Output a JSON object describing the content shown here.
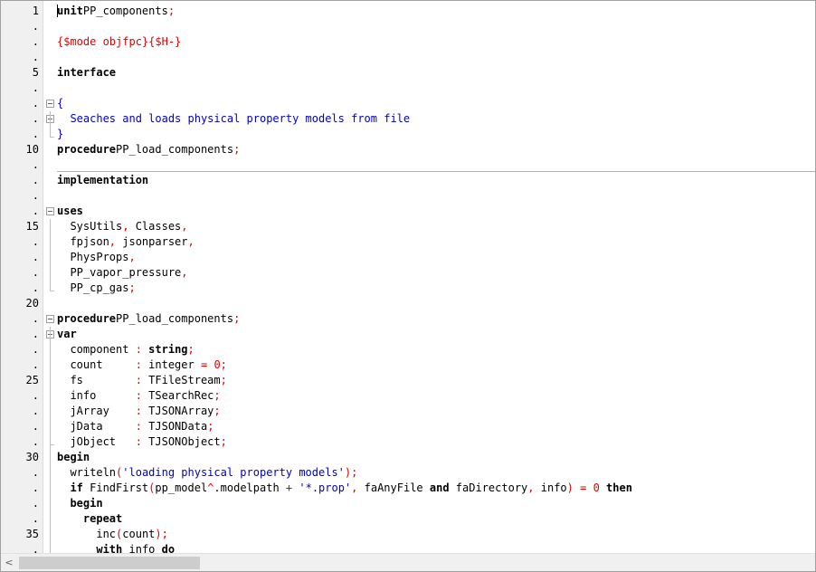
{
  "editor": {
    "lines": [
      {
        "n": "1",
        "code": [
          [
            "kw",
            "unit"
          ],
          [
            "",
            "PP_components"
          ],
          [
            "sym",
            ";"
          ]
        ]
      },
      {
        "n": ".",
        "code": []
      },
      {
        "n": ".",
        "code": [
          [
            "dir",
            "{$mode objfpc}{$H-}"
          ]
        ]
      },
      {
        "n": ".",
        "code": []
      },
      {
        "n": "5",
        "code": [
          [
            "kw",
            "interface"
          ]
        ]
      },
      {
        "n": ".",
        "code": []
      },
      {
        "n": ".",
        "code": [
          [
            "cm",
            "{"
          ]
        ]
      },
      {
        "n": ".",
        "code": [
          [
            "cm",
            "  Seaches and loads physical property models from file"
          ]
        ]
      },
      {
        "n": ".",
        "code": [
          [
            "cm",
            "}"
          ]
        ]
      },
      {
        "n": "10",
        "code": [
          [
            "kw",
            "procedure"
          ],
          [
            "",
            "PP_load_components"
          ],
          [
            "sym",
            ";"
          ]
        ]
      },
      {
        "n": ".",
        "code": []
      },
      {
        "n": ".",
        "code": [
          [
            "kw",
            "implementation"
          ]
        ]
      },
      {
        "n": ".",
        "code": []
      },
      {
        "n": ".",
        "code": [
          [
            "kw",
            "uses"
          ]
        ]
      },
      {
        "n": "15",
        "code": [
          [
            "",
            "  SysUtils"
          ],
          [
            "sym",
            ","
          ],
          [
            "",
            " Classes"
          ],
          [
            "sym",
            ","
          ]
        ]
      },
      {
        "n": ".",
        "code": [
          [
            "",
            "  fpjson"
          ],
          [
            "sym",
            ","
          ],
          [
            "",
            " jsonparser"
          ],
          [
            "sym",
            ","
          ]
        ]
      },
      {
        "n": ".",
        "code": [
          [
            "",
            "  PhysProps"
          ],
          [
            "sym",
            ","
          ]
        ]
      },
      {
        "n": ".",
        "code": [
          [
            "",
            "  PP_vapor_pressure"
          ],
          [
            "sym",
            ","
          ]
        ]
      },
      {
        "n": ".",
        "code": [
          [
            "",
            "  PP_cp_gas"
          ],
          [
            "sym",
            ";"
          ]
        ]
      },
      {
        "n": "20",
        "code": []
      },
      {
        "n": ".",
        "code": [
          [
            "kw",
            "procedure"
          ],
          [
            "",
            "PP_load_components"
          ],
          [
            "sym",
            ";"
          ]
        ]
      },
      {
        "n": ".",
        "code": [
          [
            "kw",
            "var"
          ]
        ]
      },
      {
        "n": ".",
        "code": [
          [
            "",
            "  component "
          ],
          [
            "sym",
            ":"
          ],
          [
            "",
            " "
          ],
          [
            "kw",
            "string"
          ],
          [
            "sym",
            ";"
          ]
        ]
      },
      {
        "n": ".",
        "code": [
          [
            "",
            "  count     "
          ],
          [
            "sym",
            ":"
          ],
          [
            "",
            " integer "
          ],
          [
            "sym",
            "="
          ],
          [
            "",
            " "
          ],
          [
            "num",
            "0"
          ],
          [
            "sym",
            ";"
          ]
        ]
      },
      {
        "n": "25",
        "code": [
          [
            "",
            "  fs        "
          ],
          [
            "sym",
            ":"
          ],
          [
            "",
            " TFileStream"
          ],
          [
            "sym",
            ";"
          ]
        ]
      },
      {
        "n": ".",
        "code": [
          [
            "",
            "  info      "
          ],
          [
            "sym",
            ":"
          ],
          [
            "",
            " TSearchRec"
          ],
          [
            "sym",
            ";"
          ]
        ]
      },
      {
        "n": ".",
        "code": [
          [
            "",
            "  jArray    "
          ],
          [
            "sym",
            ":"
          ],
          [
            "",
            " TJSONArray"
          ],
          [
            "sym",
            ";"
          ]
        ]
      },
      {
        "n": ".",
        "code": [
          [
            "",
            "  jData     "
          ],
          [
            "sym",
            ":"
          ],
          [
            "",
            " TJSONData"
          ],
          [
            "sym",
            ";"
          ]
        ]
      },
      {
        "n": ".",
        "code": [
          [
            "",
            "  jObject   "
          ],
          [
            "sym",
            ":"
          ],
          [
            "",
            " TJSONObject"
          ],
          [
            "sym",
            ";"
          ]
        ]
      },
      {
        "n": "30",
        "code": [
          [
            "kw",
            "begin"
          ]
        ]
      },
      {
        "n": ".",
        "code": [
          [
            "",
            "  writeln"
          ],
          [
            "sym",
            "("
          ],
          [
            "str",
            "'loading physical property models'"
          ],
          [
            "sym",
            ")"
          ],
          [
            "sym",
            ";"
          ]
        ]
      },
      {
        "n": ".",
        "code": [
          [
            "",
            "  "
          ],
          [
            "kw",
            "if"
          ],
          [
            "",
            " FindFirst"
          ],
          [
            "sym",
            "("
          ],
          [
            "",
            "pp_model"
          ],
          [
            "sym",
            "^"
          ],
          [
            "",
            ".modelpath "
          ],
          [
            "sym",
            "+"
          ],
          [
            "",
            " "
          ],
          [
            "str",
            "'*.prop'"
          ],
          [
            "sym",
            ","
          ],
          [
            "",
            " faAnyFile "
          ],
          [
            "kw",
            "and"
          ],
          [
            "",
            " faDirectory"
          ],
          [
            "sym",
            ","
          ],
          [
            "",
            " info"
          ],
          [
            "sym",
            ")"
          ],
          [
            "",
            " "
          ],
          [
            "sym",
            "="
          ],
          [
            "",
            " "
          ],
          [
            "num",
            "0"
          ],
          [
            "",
            " "
          ],
          [
            "kw",
            "then"
          ]
        ]
      },
      {
        "n": ".",
        "code": [
          [
            "",
            "  "
          ],
          [
            "kw",
            "begin"
          ]
        ]
      },
      {
        "n": ".",
        "code": [
          [
            "",
            "    "
          ],
          [
            "kw",
            "repeat"
          ]
        ]
      },
      {
        "n": "35",
        "code": [
          [
            "",
            "      inc"
          ],
          [
            "sym",
            "("
          ],
          [
            "",
            "count"
          ],
          [
            "sym",
            ")"
          ],
          [
            "sym",
            ";"
          ]
        ]
      },
      {
        "n": ".",
        "code": [
          [
            "",
            "      "
          ],
          [
            "kw",
            "with"
          ],
          [
            "",
            " info "
          ],
          [
            "kw",
            "do"
          ]
        ]
      }
    ]
  },
  "icons": {
    "fold": "collapse-box-icon",
    "scroll_left": "chevron-left-icon"
  },
  "scrollbar": {
    "left_glyph": "<"
  },
  "colors": {
    "keyword": "#000000",
    "directive": "#e00000",
    "comment": "#0000c8",
    "string": "#0000c8",
    "symbol": "#e00000",
    "gutter_bg": "#f0f0f0"
  }
}
